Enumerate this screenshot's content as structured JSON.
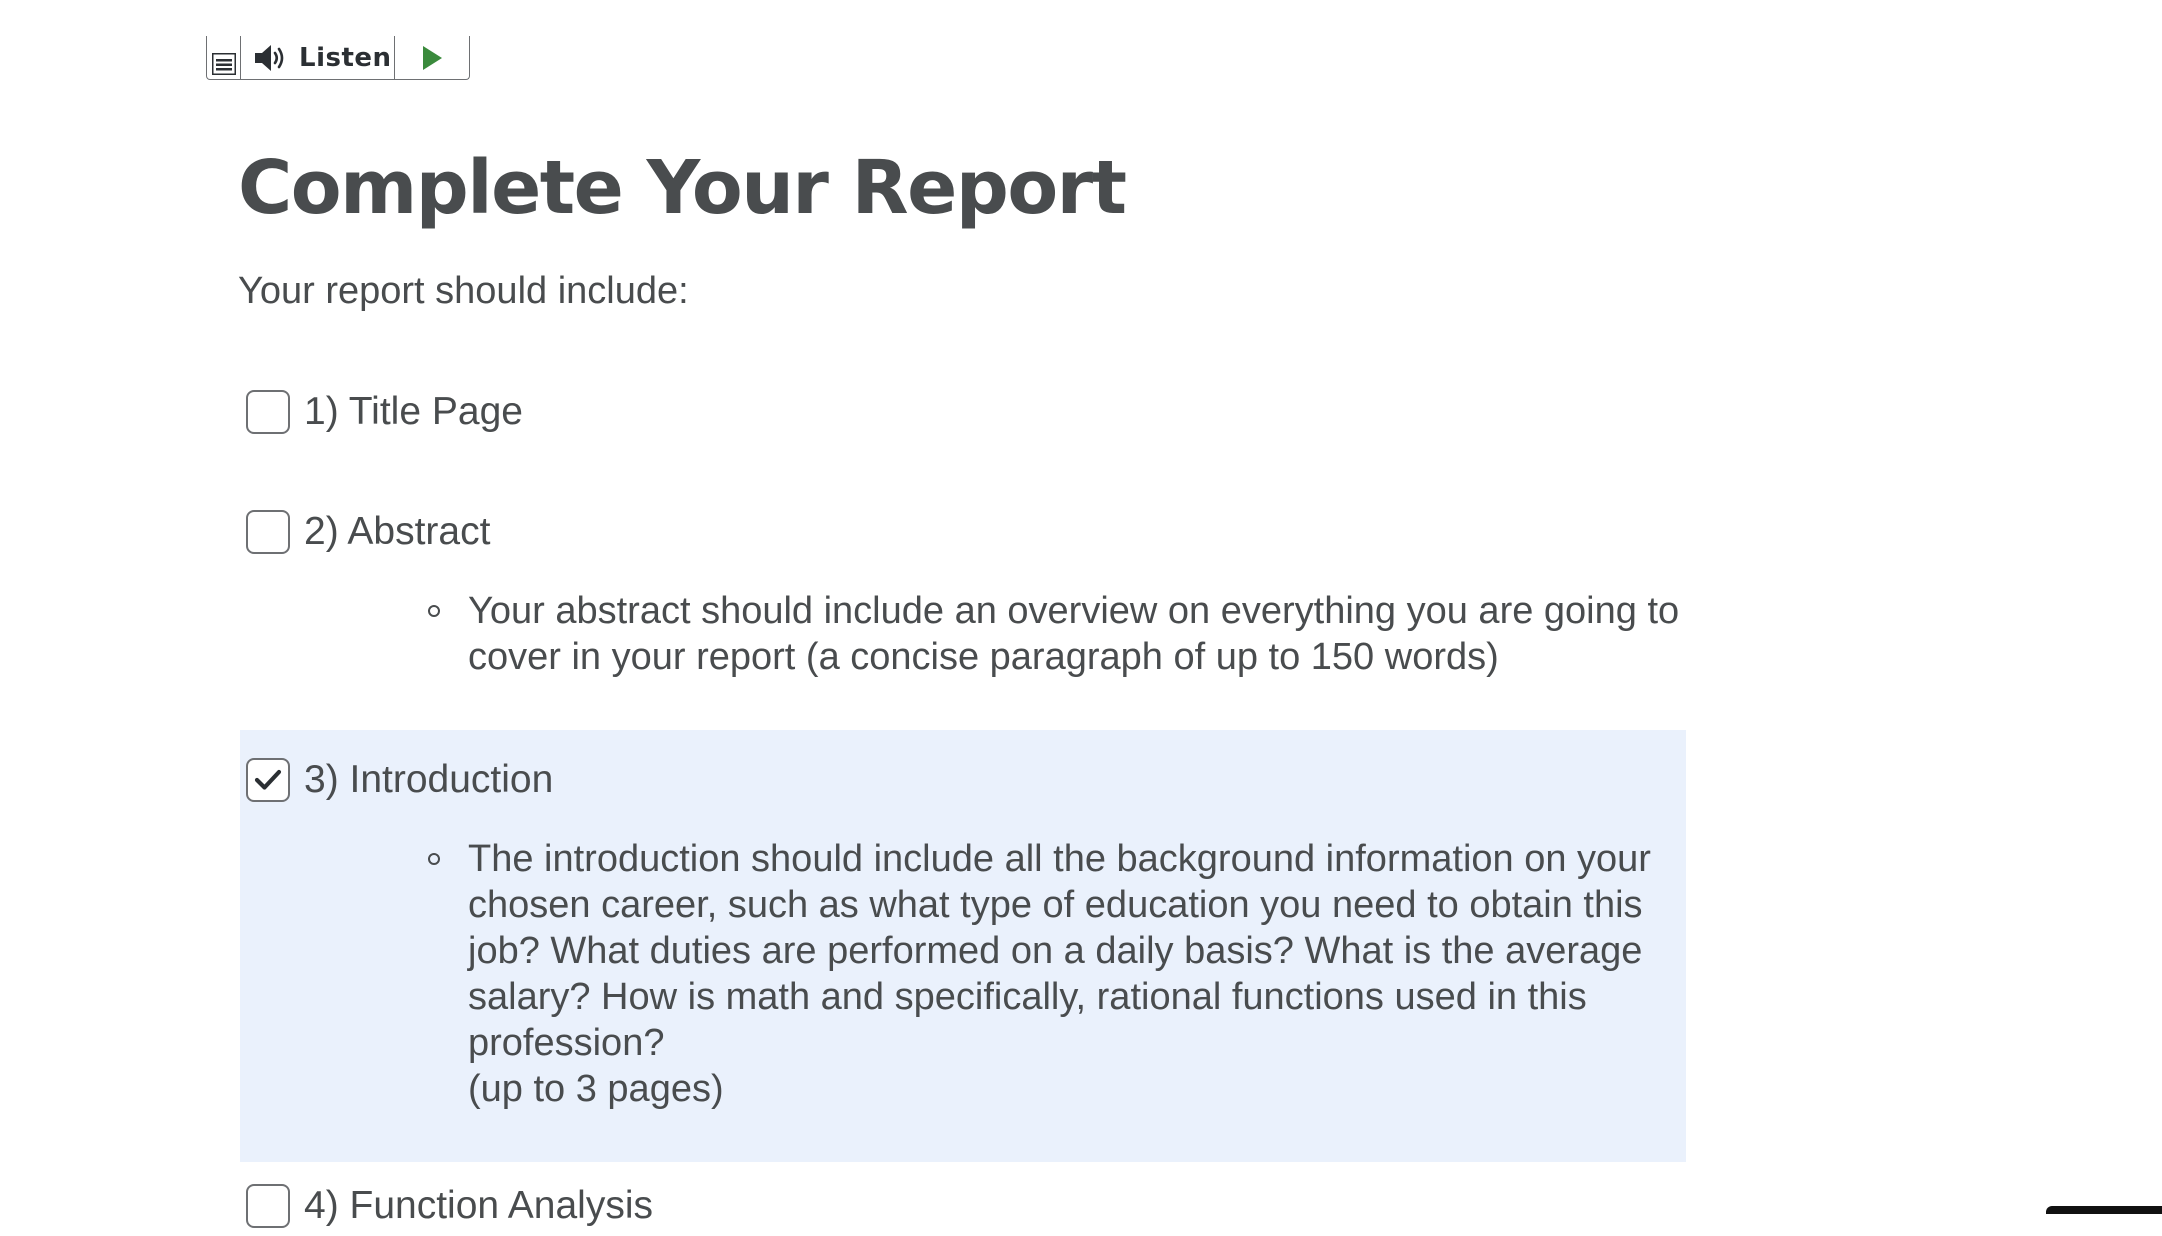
{
  "toolbar": {
    "listen_label": "Listen",
    "menu_icon": "menu-icon",
    "speaker_icon": "speaker-icon",
    "play_icon": "play-icon",
    "play_color": "#3a8a3c"
  },
  "page": {
    "title": "Complete Your Report",
    "intro": "Your report should include:"
  },
  "checklist": [
    {
      "label": "1) Title Page",
      "checked": false,
      "bullets": []
    },
    {
      "label": "2) Abstract",
      "checked": false,
      "bullets": [
        "Your abstract should include an overview on everything you are going to cover in your report (a concise paragraph of up to 150 words)"
      ]
    },
    {
      "label": "3) Introduction",
      "checked": true,
      "bullets": [
        "The introduction should include all the background information on your chosen career, such as what type of education you need to obtain this job? What duties are performed on a daily basis? What is the average salary? How is math and specifically, rational functions used in this profession?\n(up to 3 pages)"
      ]
    },
    {
      "label": "4) Function Analysis",
      "checked": false,
      "bullets": []
    }
  ],
  "colors": {
    "text": "#494c4e",
    "highlight_background": "#eaf1fc",
    "checkbox_border": "#6e7073"
  }
}
